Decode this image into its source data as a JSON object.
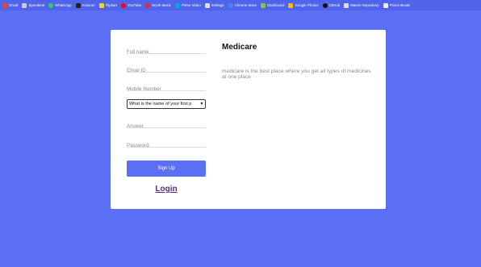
{
  "bookmarks": [
    {
      "label": "Gmail",
      "icon": "gmail-icon",
      "color": "#ea4335"
    },
    {
      "label": "Speedtest",
      "icon": "speedtest-icon",
      "color": "#cccccc"
    },
    {
      "label": "WhatsApp",
      "icon": "whatsapp-icon",
      "color": "#25d366"
    },
    {
      "label": "Amazon",
      "icon": "amazon-icon",
      "color": "#222222"
    },
    {
      "label": "Flipkart",
      "icon": "flipkart-icon",
      "color": "#f7d31f"
    },
    {
      "label": "YouTube",
      "icon": "youtube-icon",
      "color": "#ff0000"
    },
    {
      "label": "Wynk Music",
      "icon": "wynk-icon",
      "color": "#e22a2a"
    },
    {
      "label": "Prime Video",
      "icon": "prime-video-icon",
      "color": "#00a8e1"
    },
    {
      "label": "Settings",
      "icon": "gear-icon",
      "color": "#dddddd"
    },
    {
      "label": "Chrome Store",
      "icon": "chrome-store-icon",
      "color": "#4285f4"
    },
    {
      "label": "Dashboard",
      "icon": "dashboard-icon",
      "color": "#8bc34a"
    },
    {
      "label": "Google Photos",
      "icon": "google-photos-icon",
      "color": "#fbbc05"
    },
    {
      "label": "GitHub",
      "icon": "github-icon",
      "color": "#111111"
    },
    {
      "label": "Maven Repository",
      "icon": "maven-icon",
      "color": "#dddddd"
    },
    {
      "label": "Prison Break",
      "icon": "prison-break-icon",
      "color": "#eeeeee"
    }
  ],
  "form": {
    "fullname_placeholder": "Full name",
    "email_placeholder": "Email ID",
    "mobile_placeholder": "Mobile Number",
    "question_selected": "What is the name of your first p",
    "answer_placeholder": "Answer",
    "password_placeholder": "Password",
    "signup_label": "Sign Up",
    "login_label": "Login"
  },
  "info": {
    "title": "Medicare",
    "description": "medicare is the best place where you get all types of medicines at one place"
  },
  "colors": {
    "background": "#5a6ff4",
    "button": "#5a6ff4",
    "login_link": "#5a2a82"
  }
}
